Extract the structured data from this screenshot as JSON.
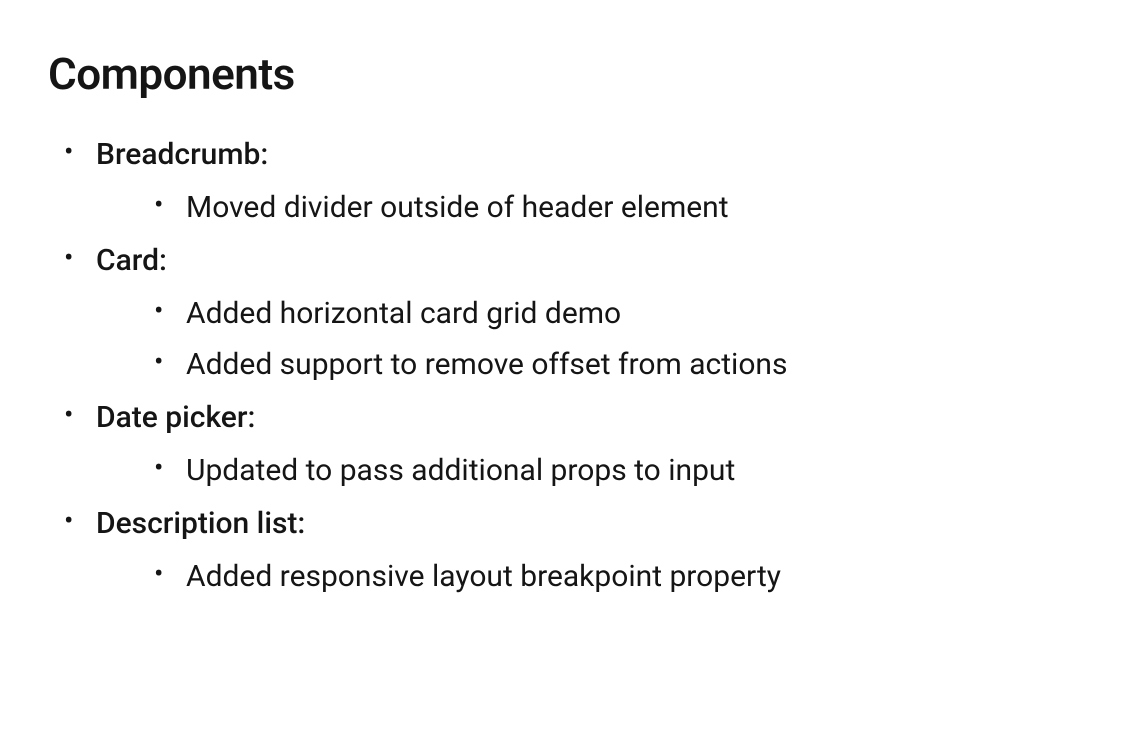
{
  "heading": "Components",
  "items": [
    {
      "name": "Breadcrumb:",
      "changes": [
        "Moved divider outside of header element"
      ]
    },
    {
      "name": "Card:",
      "changes": [
        "Added horizontal card grid demo",
        "Added support to remove offset from actions"
      ]
    },
    {
      "name": "Date picker:",
      "changes": [
        "Updated to pass additional props to input"
      ]
    },
    {
      "name": "Description list:",
      "changes": [
        "Added responsive layout breakpoint property"
      ]
    }
  ]
}
